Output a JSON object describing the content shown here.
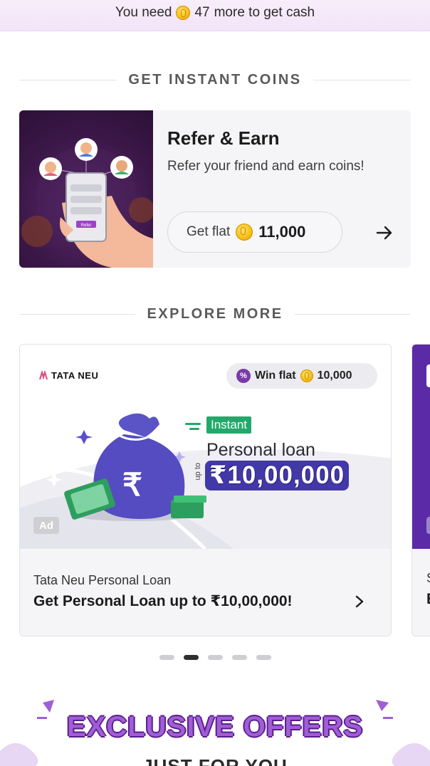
{
  "banner": {
    "prefix": "You need",
    "amount": "47",
    "suffix": "more to get cash"
  },
  "section_coins": {
    "heading": "GET INSTANT COINS"
  },
  "refer": {
    "title": "Refer & Earn",
    "subtitle": "Refer your friend and earn coins!",
    "pill_label": "Get flat",
    "pill_value": "11,000",
    "illustration_button": "Refer"
  },
  "section_explore": {
    "heading": "EXPLORE MORE"
  },
  "offer": {
    "brand": "TATA NEU",
    "win_label": "Win flat",
    "win_value": "10,000",
    "badge": "Ad",
    "instant": "Instant",
    "loan_label": "Personal loan",
    "upto": "up to",
    "loan_amount": "₹10,00,000",
    "provider": "Tata Neu Personal Loan",
    "headline": "Get Personal Loan up to ₹10,00,000!"
  },
  "next_card": {
    "t1": "S",
    "t2": "E"
  },
  "carousel": {
    "count": 5,
    "active": 1
  },
  "exclusive": {
    "title": "EXCLUSIVE OFFERS",
    "subtitle": "JUST FOR YOU"
  },
  "colors": {
    "accent": "#7b3aa8",
    "coin": "#f7c21a",
    "loan_blue": "#4338a8",
    "instant_green": "#21a96b"
  }
}
